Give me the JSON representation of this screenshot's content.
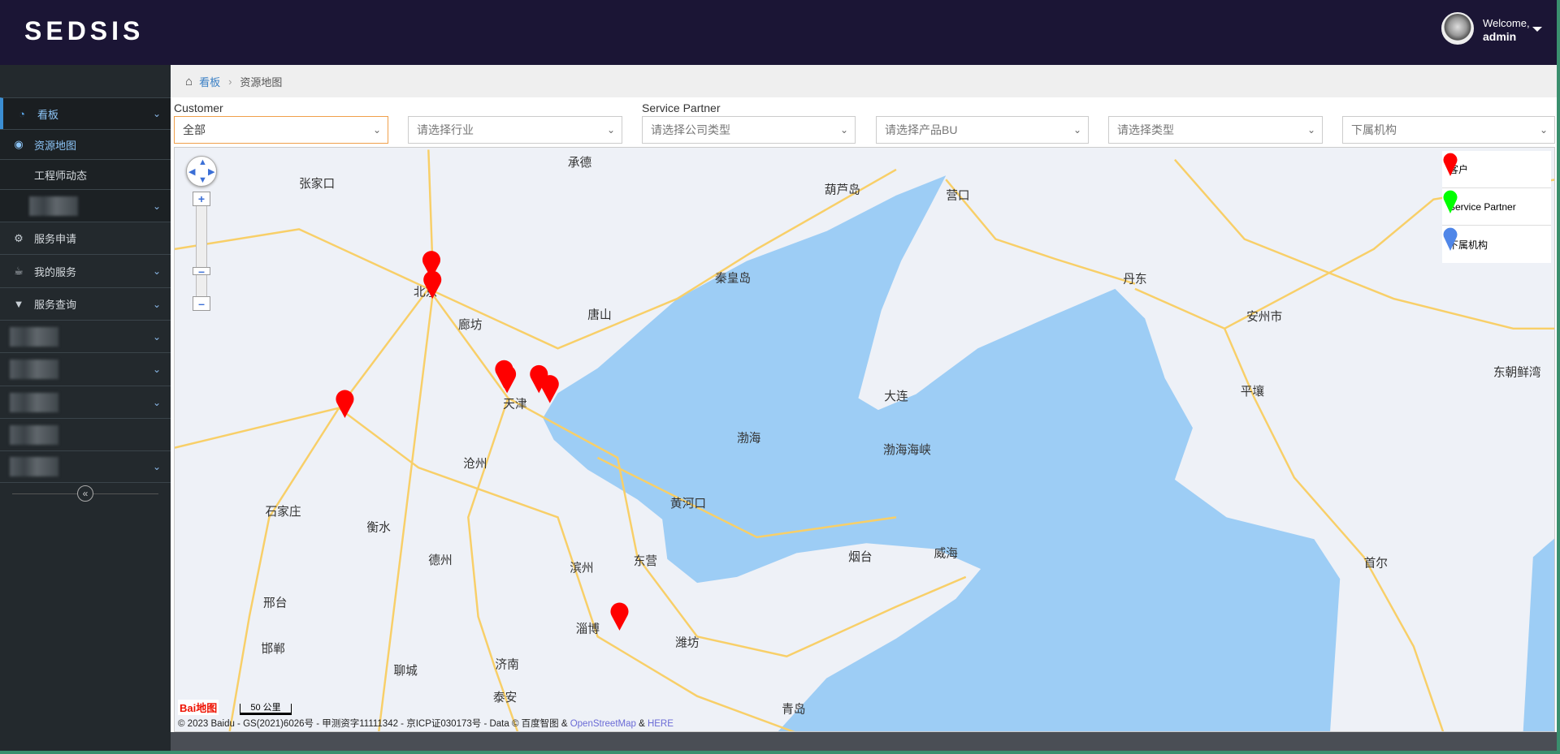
{
  "header": {
    "logo": "SEDSIS",
    "welcome": "Welcome,",
    "user": "admin"
  },
  "sidebar": {
    "items": [
      {
        "label": "看板",
        "icon": "dashboard-icon",
        "expanded": true
      },
      {
        "label": "资源地图",
        "icon": "eye-icon",
        "active": true
      },
      {
        "label": "工程师动态"
      },
      {
        "label": ""
      },
      {
        "label": "服务申请",
        "icon": "gears-icon"
      },
      {
        "label": "我的服务",
        "icon": "coffee-icon"
      },
      {
        "label": "服务查询",
        "icon": "filter-icon"
      }
    ],
    "collapse": "«"
  },
  "breadcrumb": {
    "home": "看板",
    "current": "资源地图"
  },
  "filters": {
    "customer_label": "Customer",
    "partner_label": "Service Partner",
    "selects": [
      {
        "value": "全部",
        "placeholder": false
      },
      {
        "value": "请选择行业",
        "placeholder": true
      },
      {
        "value": "请选择公司类型",
        "placeholder": true
      },
      {
        "value": "请选择产品BU",
        "placeholder": true
      },
      {
        "value": "请选择类型",
        "placeholder": true
      },
      {
        "value": "下属机构",
        "placeholder": true
      }
    ]
  },
  "legend": [
    {
      "label": "客户",
      "color": "#ff0000"
    },
    {
      "label": "Service Partner",
      "color": "#00ff00"
    },
    {
      "label": "下属机构",
      "color": "#4f86e8"
    }
  ],
  "map": {
    "labels": [
      "北京",
      "天津",
      "廊坊",
      "沧州",
      "石家庄",
      "衡水",
      "邢台",
      "邯郸",
      "聊城",
      "济南",
      "泰安",
      "德州",
      "滨州",
      "东营",
      "淄博",
      "潍坊",
      "烟台",
      "威海",
      "青岛",
      "唐山",
      "秦皇岛",
      "承德",
      "张家口",
      "葫芦岛",
      "营口",
      "大连",
      "丹东",
      "渤海",
      "渤海海峡",
      "黄河口",
      "安州市",
      "平壤",
      "首尔",
      "东朝鲜湾"
    ],
    "marker_color": "#ff0000",
    "scale": "50 公里",
    "baidu_logo": "Bai地图",
    "copyright": "© 2023 Baidu - GS(2021)6026号 - 甲测资字11111342 - 京ICP证030173号 - Data © 百度智图 & ",
    "osm": "OpenStreetMap",
    "amp": " & ",
    "here": "HERE"
  }
}
